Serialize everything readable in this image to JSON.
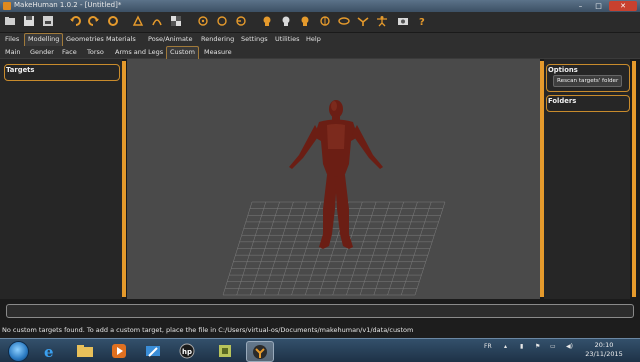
{
  "window": {
    "title": "MakeHuman 1.0.2 - [Untitled]*",
    "controls": {
      "minimize": "–",
      "maximize": "□",
      "close": "✕"
    }
  },
  "toolbar": {
    "icons": [
      "folder-icon",
      "save-icon",
      "export-icon",
      "undo-icon",
      "redo-icon",
      "reset-icon",
      "wireframe-icon",
      "smooth-icon",
      "grid-icon",
      "front-view-icon",
      "back-view-icon",
      "left-view-icon",
      "right-view-icon",
      "top-view-icon",
      "bottom-view-icon",
      "reset-camera-icon",
      "symmetry-icon",
      "pose-icon",
      "screenshot-icon",
      "help-icon"
    ]
  },
  "menu": {
    "tabs": [
      "Files",
      "Modelling",
      "Geometries",
      "Materials",
      "Pose/Animate",
      "Rendering",
      "Settings",
      "Utilities",
      "Help"
    ],
    "active": "Modelling"
  },
  "submenu": {
    "tabs": [
      "Main",
      "Gender",
      "Face",
      "Torso",
      "Arms and Legs",
      "Custom",
      "Measure"
    ],
    "active": "Custom"
  },
  "left_panel": {
    "title": "Targets"
  },
  "right_panel": {
    "options_title": "Options",
    "rescan_button": "Rescan targets' folder",
    "folders_title": "Folders"
  },
  "status": {
    "message": "No custom targets found. To add a custom target, place the file in C:/Users/virtual-os/Documents/makehuman/v1/data/custom"
  },
  "taskbar": {
    "apps": [
      "ie-icon",
      "explorer-icon",
      "media-player-icon",
      "remote-icon",
      "hp-icon",
      "sandbox-icon",
      "makehuman-icon"
    ],
    "language": "FR",
    "time": "20:10",
    "date": "23/11/2015"
  },
  "colors": {
    "accent": "#e59a2c",
    "viewport": "#4a4a4a",
    "figure": "#6b1e14"
  }
}
